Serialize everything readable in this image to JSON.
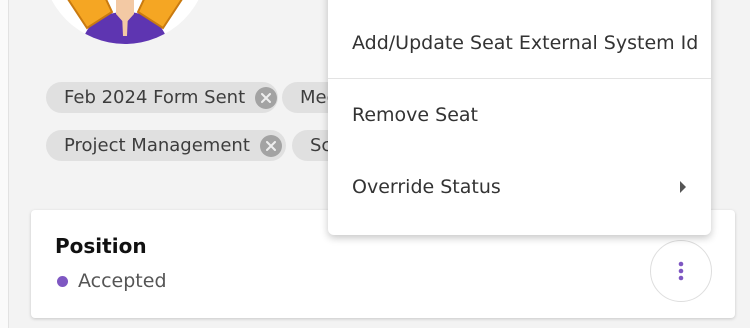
{
  "tags": [
    {
      "label": "Feb 2024 Form Sent"
    },
    {
      "label": "Med"
    },
    {
      "label": "Project Management"
    },
    {
      "label": "Sc"
    }
  ],
  "card": {
    "title": "Position",
    "status": "Accepted",
    "status_color": "#7e57c2"
  },
  "menu": {
    "items": [
      {
        "label": "Add/Update Seat External System Id"
      },
      {
        "label": "Remove Seat"
      },
      {
        "label": "Override Status",
        "icon": "chevron-right-icon"
      }
    ]
  },
  "colors": {
    "accent": "#7e57c2",
    "avatar_orange": "#f5a623",
    "avatar_purple": "#5e35b1"
  },
  "icons": {
    "tag_remove": "close-circle-icon",
    "more": "more-vertical-icon"
  }
}
